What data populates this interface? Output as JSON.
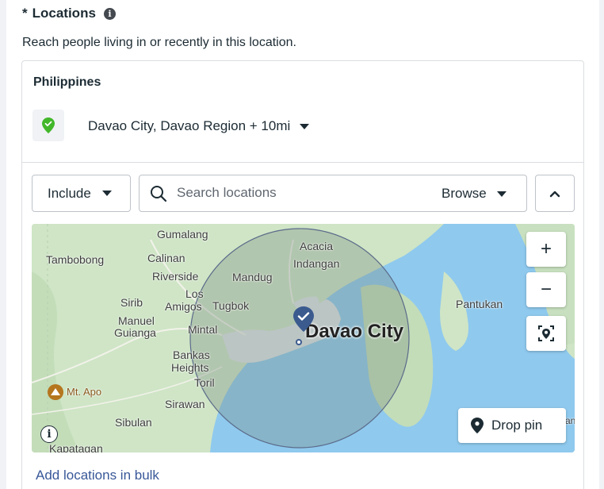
{
  "section": {
    "required_marker": "*",
    "title": "Locations",
    "info_icon": "info-icon",
    "description": "Reach people living in or recently in this location."
  },
  "selected": {
    "country": "Philippines",
    "location": "Davao City, Davao Region + 10mi",
    "pin_color": "#42b72a"
  },
  "controls": {
    "include_label": "Include",
    "search_placeholder": "Search locations",
    "browse_label": "Browse"
  },
  "map": {
    "places": {
      "gumalang": "Gumalang",
      "acacia": "Acacia",
      "tambobong": "Tambobong",
      "calinan": "Calinan",
      "indangan": "Indangan",
      "riverside": "Riverside",
      "mandug": "Mandug",
      "los": "Los",
      "amigos": "Amigos",
      "tugbok": "Tugbok",
      "sirib": "Sirib",
      "pantukan": "Pantukan",
      "manuel": "Manuel",
      "guianga": "Guianga",
      "mintal": "Mintal",
      "davao_city": "Davao City",
      "bankas": "Bankas",
      "heights": "Heights",
      "toril": "Toril",
      "mt_apo": "Mt. Apo",
      "sirawan": "Sirawan",
      "sibulan": "Sibulan",
      "kapatagan": "Kapatagan",
      "edge_an": "an"
    },
    "zoom_in": "+",
    "zoom_out": "−",
    "drop_pin_label": "Drop pin",
    "info_label": "i",
    "colors": {
      "land": "#cfe5c6",
      "water": "#8fc9ee",
      "urban": "#dfe3e8",
      "radius": "rgba(120,140,130,0.35)",
      "pin": "#3b5b8f"
    }
  },
  "footer": {
    "bulk_link": "Add locations in bulk"
  }
}
